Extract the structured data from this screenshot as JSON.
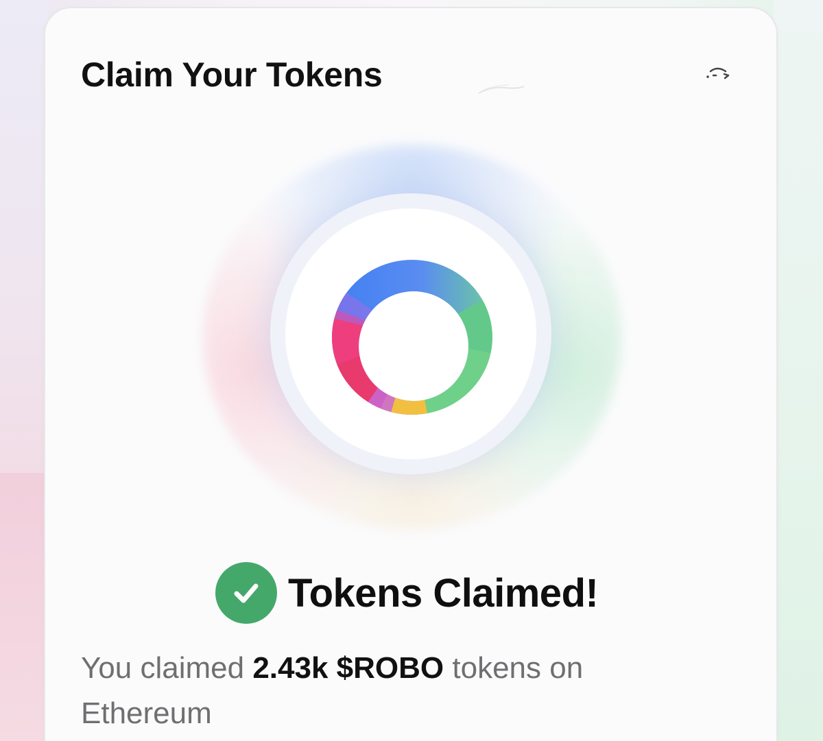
{
  "card": {
    "title": "Claim Your Tokens"
  },
  "icons": {
    "refresh": "refresh-icon",
    "logo": "rainbow-ring-logo",
    "check": "check-circle-icon"
  },
  "status": {
    "label": "Tokens Claimed!"
  },
  "claim": {
    "prefix": "You claimed",
    "amount": "2.43k $ROBO",
    "suffix": "tokens on",
    "network": "Ethereum"
  },
  "colors": {
    "success": "#45a86b",
    "title": "#111111",
    "muted": "#6f6f72",
    "logo_blue": "#4a86f0",
    "logo_green": "#6fd08a",
    "logo_pink": "#ee3e7e",
    "logo_yellow": "#f2c040"
  }
}
